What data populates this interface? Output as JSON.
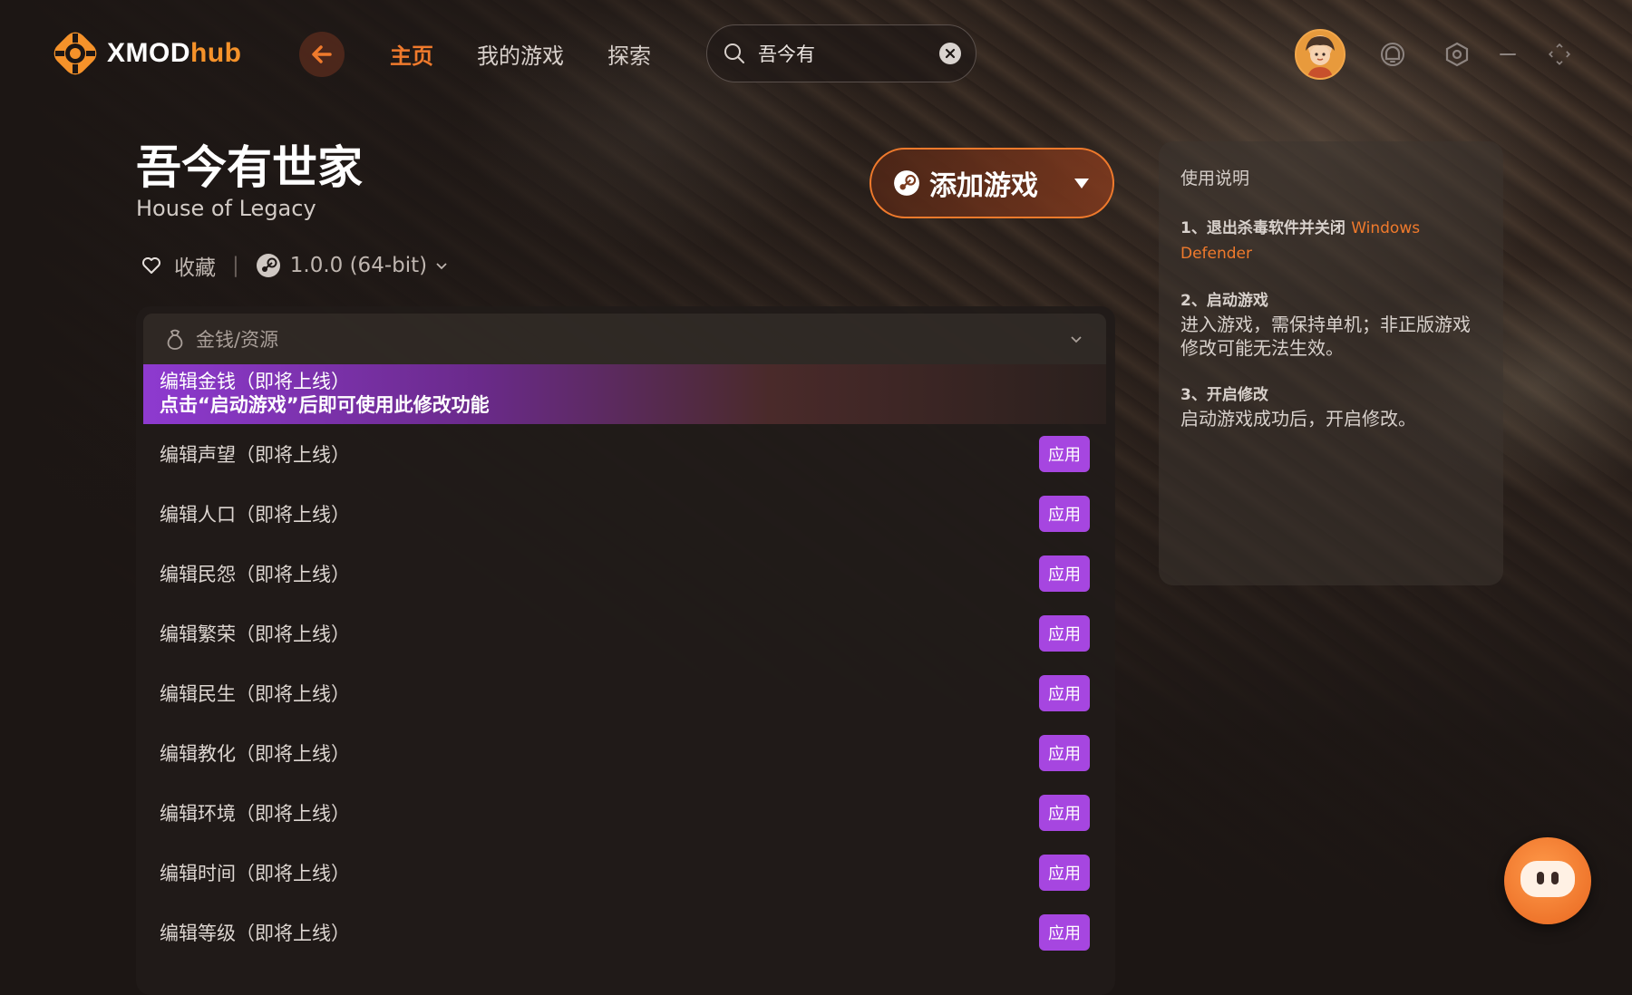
{
  "app": {
    "brand_primary": "XMOD",
    "brand_secondary": "hub",
    "accent_color": "#f07a2c",
    "purple_color": "#a646e0"
  },
  "nav": {
    "items": [
      {
        "label": "主页",
        "active": true
      },
      {
        "label": "我的游戏",
        "active": false
      },
      {
        "label": "探索",
        "active": false
      }
    ]
  },
  "search": {
    "value": "吾今有",
    "icon": "search-icon",
    "clear_icon": "close-icon"
  },
  "header_icons": [
    "avatar",
    "notification-icon",
    "settings-icon",
    "minimize-icon",
    "fullscreen-icon"
  ],
  "game": {
    "title": "吾今有世家",
    "subtitle": "House of Legacy",
    "favorite_label": "收藏",
    "version": "1.0.0 (64-bit)"
  },
  "add_game": {
    "label": "添加游戏"
  },
  "category": {
    "label": "金钱/资源"
  },
  "highlight": {
    "line1": "编辑金钱（即将上线）",
    "line2": "点击“启动游戏”后即可使用此修改功能"
  },
  "mods": [
    {
      "name": "编辑声望（即将上线）",
      "action": "应用"
    },
    {
      "name": "编辑人口（即将上线）",
      "action": "应用"
    },
    {
      "name": "编辑民怨（即将上线）",
      "action": "应用"
    },
    {
      "name": "编辑繁荣（即将上线）",
      "action": "应用"
    },
    {
      "name": "编辑民生（即将上线）",
      "action": "应用"
    },
    {
      "name": "编辑教化（即将上线）",
      "action": "应用"
    },
    {
      "name": "编辑环境（即将上线）",
      "action": "应用"
    },
    {
      "name": "编辑时间（即将上线）",
      "action": "应用"
    },
    {
      "name": "编辑等级（即将上线）",
      "action": "应用"
    }
  ],
  "instructions": {
    "title": "使用说明",
    "steps": [
      {
        "title": "1、退出杀毒软件并关闭",
        "highlight": "Windows Defender",
        "body": ""
      },
      {
        "title": "2、启动游戏",
        "highlight": "",
        "body": "进入游戏，需保持单机；非正版游戏修改可能无法生效。"
      },
      {
        "title": "3、开启修改",
        "highlight": "",
        "body": "启动游戏成功后，开启修改。"
      }
    ]
  }
}
